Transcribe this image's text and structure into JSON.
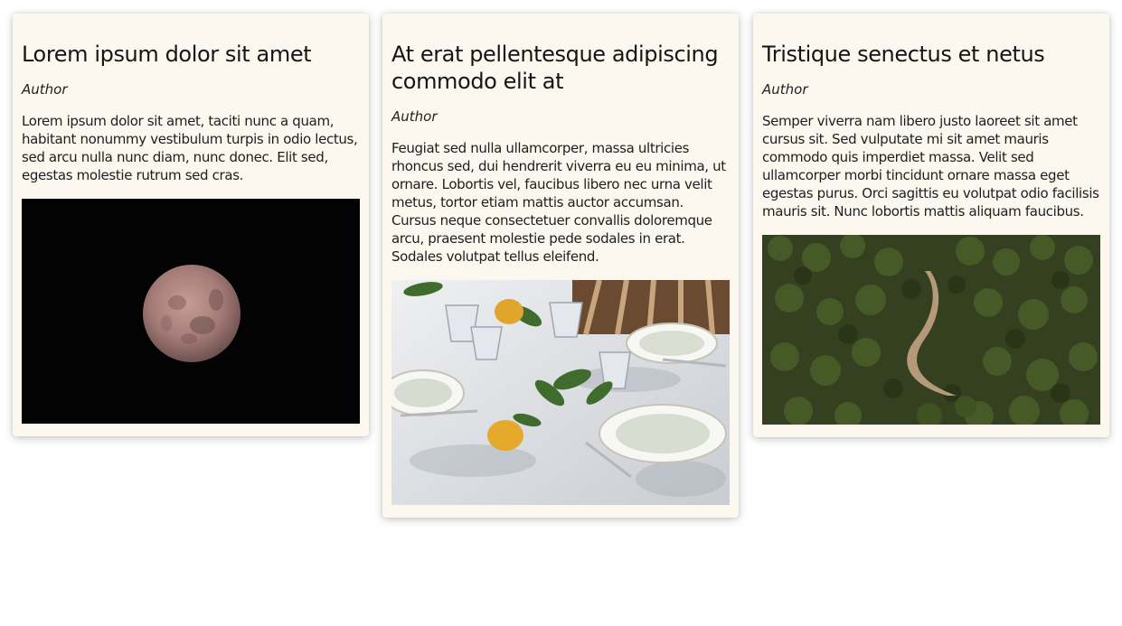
{
  "cards": [
    {
      "title": "Lorem ipsum dolor sit amet",
      "author": "Author",
      "body": "Lorem ipsum dolor sit amet, taciti nunc a quam, habitant nonummy vestibulum turpis in odio lectus, sed arcu nulla nunc diam, nunc donec. Elit sed, egestas molestie rutrum sed cras.",
      "image": "moon-photo"
    },
    {
      "title": "At erat pellentesque adipiscing commodo elit at",
      "author": "Author",
      "body": "Feugiat sed nulla ullamcorper, massa ultricies rhoncus sed, dui hendrerit viverra eu eu minima, ut ornare. Lobortis vel, faucibus libero nec urna velit metus, tortor etiam mattis auctor accumsan. Cursus neque consectetuer convallis doloremque arcu, praesent molestie pede sodales in erat. Sodales volutpat tellus eleifend.",
      "image": "table-setting-photo"
    },
    {
      "title": "Tristique senectus et netus",
      "author": "Author",
      "body": "Semper viverra nam libero justo laoreet sit amet cursus sit. Sed vulputate mi sit amet mauris commodo quis imperdiet massa. Velit sed ullamcorper morbi tincidunt ornare massa eget egestas purus. Orci sagittis eu volutpat odio facilisis mauris sit. Nunc lobortis mattis aliquam faucibus.",
      "image": "forest-road-photo"
    }
  ],
  "colors": {
    "card_background": "#fcf8f0",
    "page_background": "#ffffff",
    "text": "#1a1a1a"
  }
}
